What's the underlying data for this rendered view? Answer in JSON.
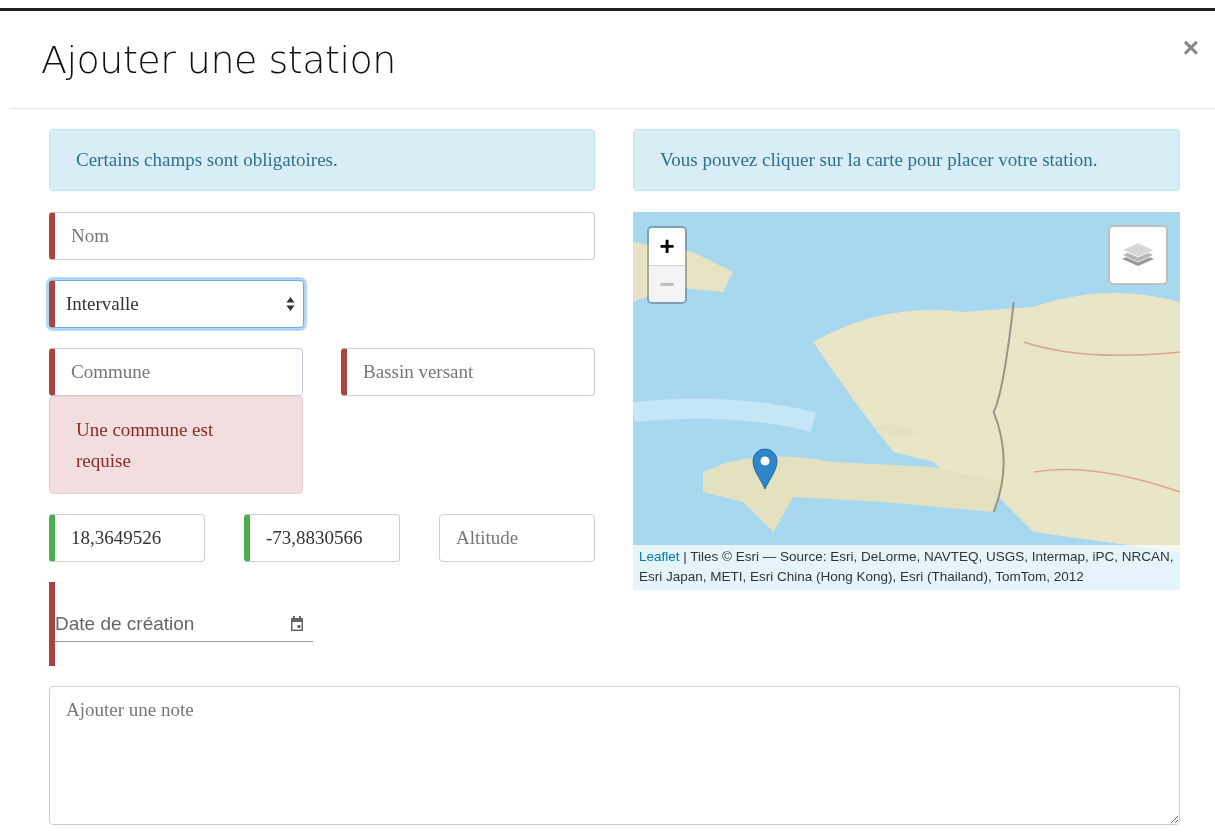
{
  "modal": {
    "title": "Ajouter une station",
    "close": "×"
  },
  "form_notice": {
    "text": "Certains champs sont obligatoires."
  },
  "map_notice": {
    "text": "Vous pouvez cliquer sur la carte pour placer votre station."
  },
  "name_field": {
    "placeholder": "Nom",
    "invalid": true,
    "valid": false
  },
  "interval_select": {
    "value": "Intervalle",
    "invalid": true,
    "valid": false,
    "focused": true
  },
  "commune_field": {
    "placeholder": "Commune",
    "invalid": true,
    "valid": false,
    "error": "Une commune est requise"
  },
  "basin_field": {
    "placeholder": "Bassin versant",
    "invalid": true,
    "valid": false
  },
  "coordinate_fields": [
    {
      "value": "18,3649526",
      "invalid": false,
      "valid": true
    },
    {
      "value": "-73,8830566",
      "invalid": false,
      "valid": true
    },
    {
      "placeholder": "Altitude",
      "invalid": false,
      "valid": false
    }
  ],
  "date_field": {
    "placeholder": "Date de création",
    "invalid": true,
    "valid": false
  },
  "map": {
    "zoom_in": "+",
    "zoom_out": "−",
    "zoom_out_disabled": true,
    "attribution_link": "Leaflet",
    "attribution": "| Tiles © Esri — Source: Esri, DeLorme, NAVTEQ, USGS, Intermap, iPC, NRCAN, Esri Japan, METI, Esri China (Hong Kong), Esri (Thailand), TomTom, 2012"
  },
  "note_field": {
    "placeholder": "Ajouter une note"
  }
}
